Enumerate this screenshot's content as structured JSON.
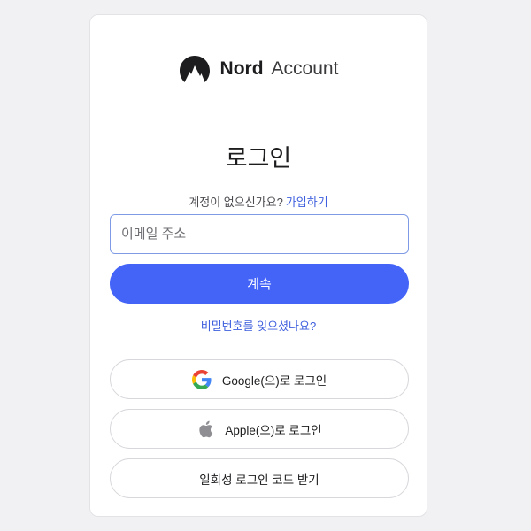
{
  "brand": {
    "name_strong": "Nord",
    "name_light": "Account"
  },
  "login": {
    "title": "로그인",
    "no_account_text": "계정이 없으신가요?",
    "signup_link": "가입하기",
    "email_placeholder": "이메일 주소",
    "email_value": "",
    "continue_label": "계속",
    "forgot_password": "비밀번호를 잊으셨나요?"
  },
  "sso": {
    "google_label": "Google(으)로 로그인",
    "apple_label": "Apple(으)로 로그인",
    "one_time_code_label": "일회성 로그인 코드 받기"
  },
  "icons": {
    "brand": "nord-mountain-icon",
    "google": "google-icon",
    "apple": "apple-icon"
  },
  "colors": {
    "accent": "#4464f8",
    "link": "#3e5fde",
    "input_border_focus": "#7f9be6"
  }
}
